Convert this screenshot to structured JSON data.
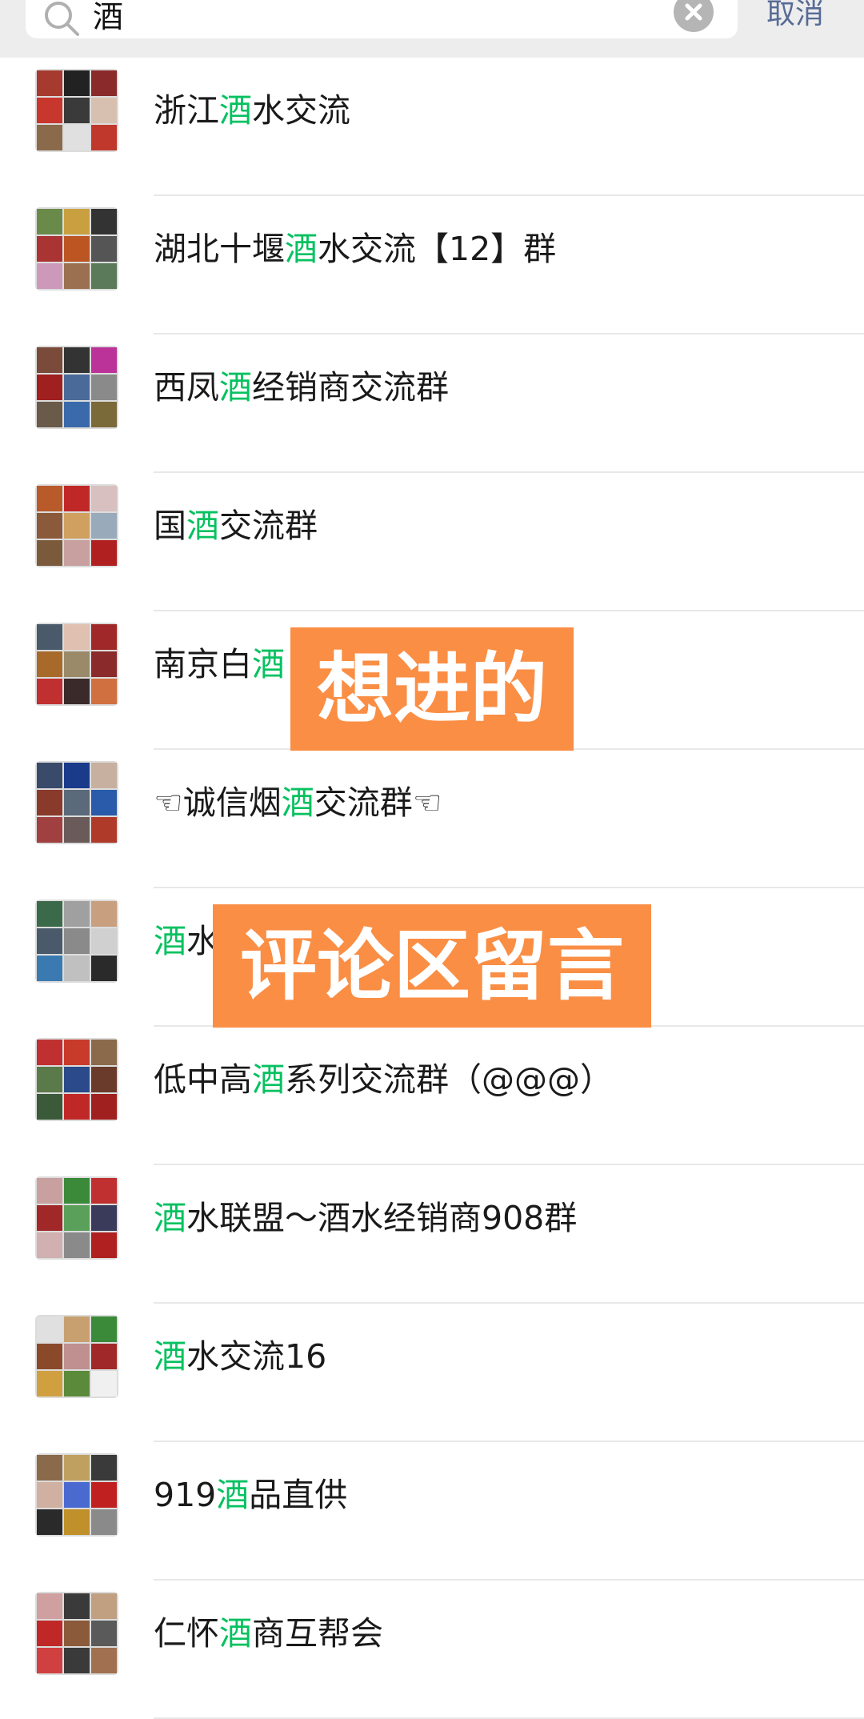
{
  "search": {
    "query": "酒",
    "cancel_label": "取消"
  },
  "results": [
    {
      "before": "浙江",
      "hl": "酒",
      "after": "水交流",
      "tiles": [
        "#a63a2e",
        "#222",
        "#8a2a2a",
        "#c8372d",
        "#3a3a3a",
        "#d8c0b0",
        "#8a6a4a",
        "#e0e0e0",
        "#c0382b"
      ]
    },
    {
      "before": "湖北十堰",
      "hl": "酒",
      "after": "水交流【12】群",
      "tiles": [
        "#6a8a4a",
        "#c8a040",
        "#333",
        "#a33",
        "#b52",
        "#555",
        "#c9b",
        "#9a7050",
        "#5a7a5a"
      ]
    },
    {
      "before": "西凤",
      "hl": "酒",
      "after": "经销商交流群",
      "tiles": [
        "#7a4a3a",
        "#333",
        "#b39",
        "#a02020",
        "#4a6a9a",
        "#8a8a8a",
        "#6a5a4a",
        "#3a6aaa",
        "#7a6a3a"
      ]
    },
    {
      "before": "国",
      "hl": "酒",
      "after": "交流群",
      "tiles": [
        "#b85a2a",
        "#c02828",
        "#d8c0c0",
        "#8a5a3a",
        "#d0a060",
        "#9ab",
        "#7a5a3a",
        "#c8a0a0",
        "#b02020"
      ]
    },
    {
      "before": "南京白",
      "hl": "酒",
      "after": "",
      "tiles": [
        "#4a5a6a",
        "#e0c0b0",
        "#a02828",
        "#a86a2a",
        "#9a8a6a",
        "#8a2a2a",
        "#c03030",
        "#3a2a2a",
        "#d07040"
      ]
    },
    {
      "before": "☜诚信烟",
      "hl": "酒",
      "after": "交流群☜",
      "tiles": [
        "#3a4a6a",
        "#1a3a8a",
        "#c8b0a0",
        "#8a3a2a",
        "#5a6a7a",
        "#2a5aaa",
        "#a04040",
        "#6a5a5a",
        "#b03a2a"
      ]
    },
    {
      "before": "",
      "hl": "酒",
      "after": "水",
      "tiles": [
        "#3a6a4a",
        "#a0a0a0",
        "#c8a080",
        "#4a5a6a",
        "#8a8a8a",
        "#d0d0d0",
        "#3a7ab0",
        "#c0c0c0",
        "#2a2a2a"
      ]
    },
    {
      "before": "低中高",
      "hl": "酒",
      "after": "系列交流群（@@@）",
      "tiles": [
        "#c03030",
        "#c83a2a",
        "#8a6a4a",
        "#5a7a4a",
        "#2a4a8a",
        "#6a3a2a",
        "#3a5a3a",
        "#c02828",
        "#a02020"
      ]
    },
    {
      "before": "",
      "hl": "酒",
      "after": "水联盟～酒水经销商908群",
      "tiles": [
        "#c8a0a0",
        "#3a8a3a",
        "#c03030",
        "#a02828",
        "#5aa05a",
        "#3a3a5a",
        "#d0b0b0",
        "#8a8a8a",
        "#b02020"
      ]
    },
    {
      "before": "",
      "hl": "酒",
      "after": "水交流16",
      "tiles": [
        "#e0e0e0",
        "#c8a070",
        "#3a8a3a",
        "#8a4a2a",
        "#c09090",
        "#a02828",
        "#d0a040",
        "#5a8a3a",
        "#f0f0f0"
      ]
    },
    {
      "before": "919",
      "hl": "酒",
      "after": "品直供",
      "tiles": [
        "#8a6a4a",
        "#c0a060",
        "#3a3a3a",
        "#d0b0a0",
        "#4a6ad0",
        "#c02020",
        "#2a2a2a",
        "#c0902a",
        "#8a8a8a"
      ]
    },
    {
      "before": "仁怀",
      "hl": "酒",
      "after": "商互帮会",
      "tiles": [
        "#d0a0a0",
        "#3a3a3a",
        "#c0a080",
        "#c02828",
        "#8a5a3a",
        "#5a5a5a",
        "#d04040",
        "#3a3a3a",
        "#a07050"
      ]
    }
  ],
  "overlays": {
    "banner_1": "想进的",
    "banner_2": "评论区留言"
  },
  "colors": {
    "highlight": "#07c160",
    "banner": "#fa8e44",
    "cancel": "#576b95"
  },
  "icons": {
    "search": "search-icon",
    "clear": "clear-icon"
  }
}
